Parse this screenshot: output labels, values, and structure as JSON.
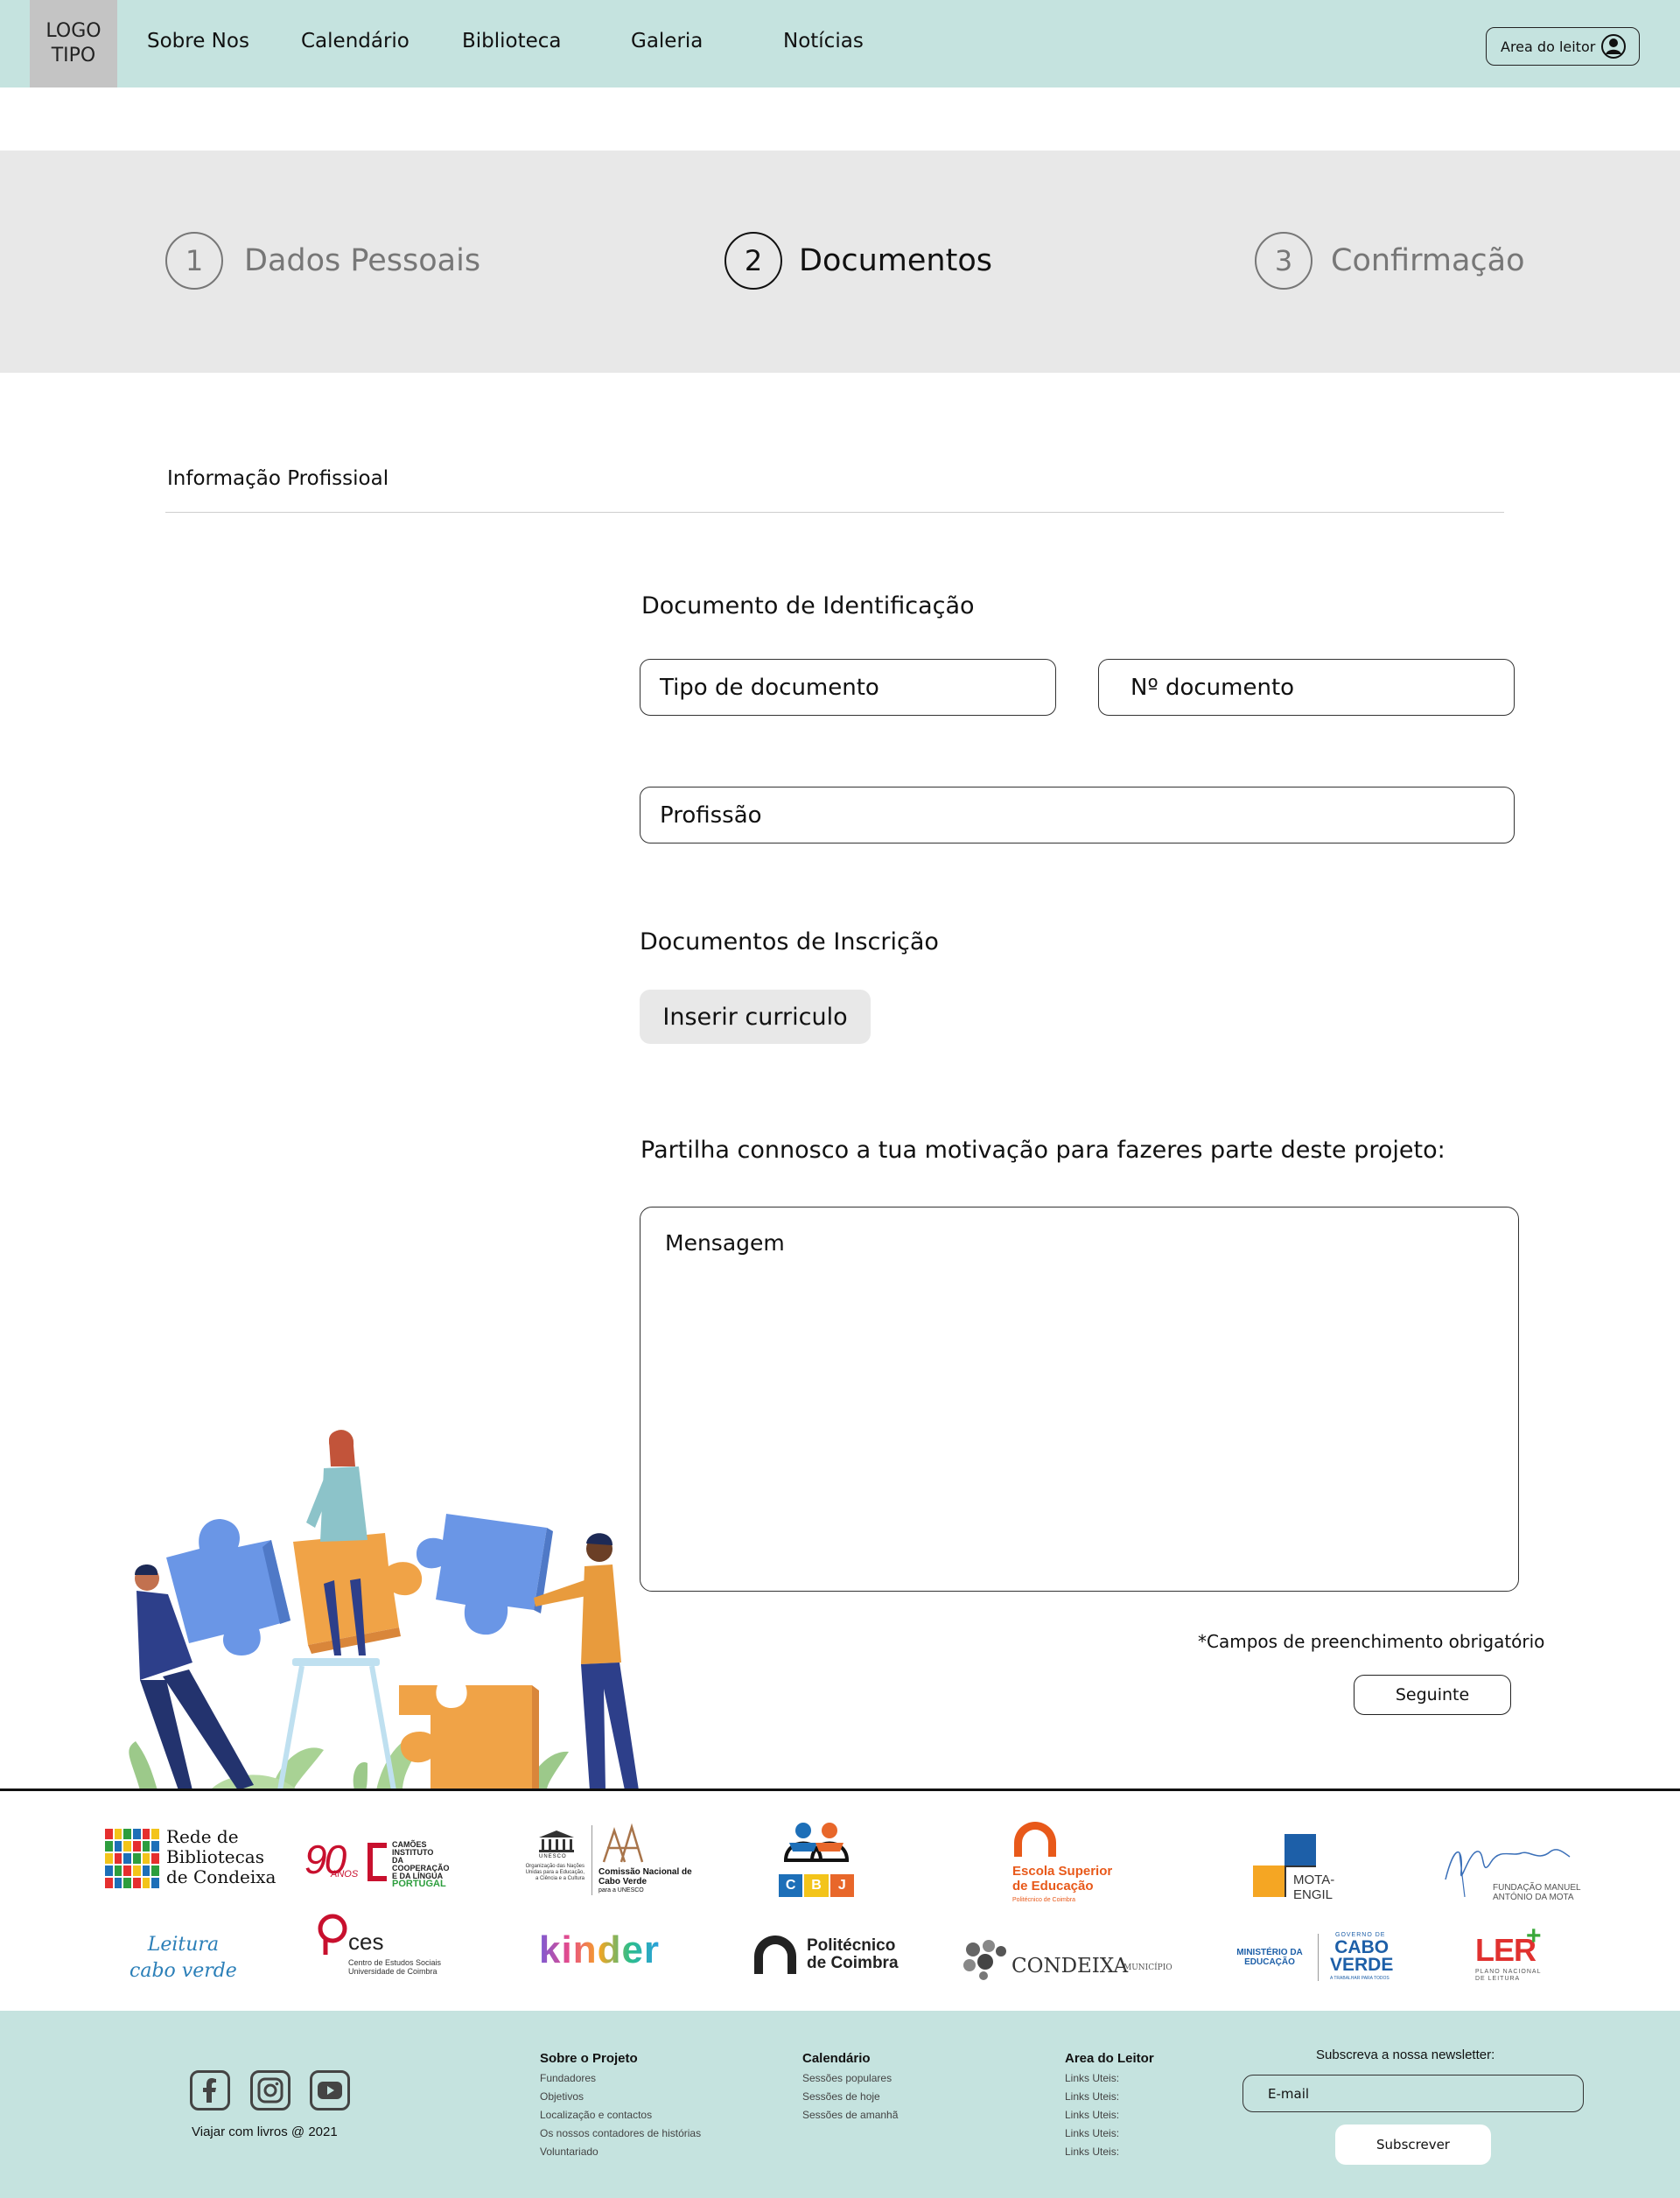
{
  "header": {
    "logo": "LOGO\nTIPO",
    "nav": [
      "Sobre Nos",
      "Calendário",
      "Biblioteca",
      "Galeria",
      "Notícias"
    ],
    "reader_area": "Area do leitor"
  },
  "steps": [
    {
      "number": "1",
      "label": "Dados Pessoais",
      "active": false
    },
    {
      "number": "2",
      "label": "Documentos",
      "active": true
    },
    {
      "number": "3",
      "label": "Confirmação",
      "active": false
    }
  ],
  "form": {
    "section_title": "Informação Profissioal",
    "id_doc_label": "Documento de Identificação",
    "doc_type_placeholder": "Tipo de documento",
    "doc_number_placeholder": "Nº documento",
    "profession_placeholder": "Profissão",
    "inscription_docs_label": "Documentos de Inscrição",
    "upload_button": "Inserir curriculo",
    "motivation_label": "Partilha connosco a tua motivação para fazeres parte deste projeto:",
    "message_placeholder": "Mensagem",
    "required_note": "*Campos de preenchimento obrigatório",
    "next_button": "Seguinte"
  },
  "partners": {
    "rede": [
      "Rede de",
      "Bibliotecas",
      "de Condeixa"
    ],
    "camoes_90": "90",
    "camoes_anos": "ANOS",
    "camoes_name": "CAMÕES",
    "camoes_line1": "INSTITUTO",
    "camoes_line2": "DA COOPERAÇÃO",
    "camoes_line3": "E DA LÍNGUA",
    "camoes_country": "PORTUGAL",
    "unesco": "UNESCO",
    "unesco_org": "Organização das Nações Unidas para a Educação, a Ciência e a Cultura",
    "unesco_comissao": "Comissão Nacional de Cabo Verde",
    "unesco_para": "para a UNESCO",
    "cbj": [
      "C",
      "B",
      "J"
    ],
    "escola_line1": "Escola Superior",
    "escola_line2": "de Educação",
    "escola_sub": "Politécnico de Coimbra",
    "motaengil": "MOTA-ENGIL",
    "fundacao_line1": "FUNDAÇÃO MANUEL",
    "fundacao_line2": "ANTÓNIO DA MOTA",
    "leitura_line1": "Leitura",
    "leitura_line2": "cabo verde",
    "ces": "ces",
    "ces_line1": "Centro de Estudos Sociais",
    "ces_line2": "Universidade de Coimbra",
    "kinder": "kinder",
    "politecnico_line1": "Politécnico",
    "politecnico_line2": "de Coimbra",
    "condeixa": "CONDEIXA",
    "condeixa_sub": "MUNICÍPIO",
    "ministerio_line1": "MINISTÉRIO DA",
    "ministerio_line2": "EDUCAÇÃO",
    "governo": "GOVERNO DE",
    "caboverde_line1": "CABO",
    "caboverde_line2": "VERDE",
    "governo_sub": "A TRABALHAR PARA TODOS",
    "ler": "LER",
    "ler_line1": "PLANO NACIONAL",
    "ler_line2": "DE LEITURA"
  },
  "footer": {
    "copyright": "Viajar com livros @ 2021",
    "columns": [
      {
        "title": "Sobre o Projeto",
        "links": [
          "Fundadores",
          "Objetivos",
          "Localização e contactos",
          "Os nossos contadores de histórias",
          "Voluntariado"
        ]
      },
      {
        "title": "Calendário",
        "links": [
          "Sessões populares",
          "Sessões de hoje",
          "Sessões de amanhã"
        ]
      },
      {
        "title": "Area do Leitor",
        "links": [
          "Links Uteis:",
          "Links Uteis:",
          "Links Uteis:",
          "Links Uteis:",
          "Links Uteis:"
        ]
      }
    ],
    "newsletter_label": "Subscreva a nossa newsletter:",
    "email_placeholder": "E-mail",
    "subscribe_button": "Subscrever"
  },
  "colors": {
    "header_bg": "#c5e3df",
    "steps_bg": "#e8e8e8",
    "button_gray": "#e8e8e8",
    "puzzle_blue": "#6a96e6",
    "puzzle_orange": "#f0a347"
  }
}
